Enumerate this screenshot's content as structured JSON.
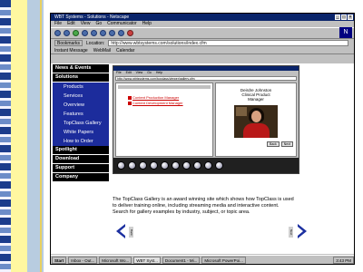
{
  "window": {
    "title": "WBT Systems - Solutions - Netscape",
    "controls": [
      "_",
      "□",
      "×"
    ]
  },
  "menubar": [
    "File",
    "Edit",
    "View",
    "Go",
    "Communicator",
    "Help"
  ],
  "location": {
    "bookmarks_label": "Bookmarks",
    "location_label": "Location:",
    "url": "http://www.wbtsystems.com/solutions/index.cfm"
  },
  "personal_toolbar": [
    "Instant Message",
    "WebMail",
    "Calendar"
  ],
  "nav": {
    "sections": [
      "News & Events",
      "Solutions"
    ],
    "solutions_items": [
      "Products",
      "Services",
      "Overview",
      "Features",
      "TopClass Gallery",
      "White Papers",
      "How to Order"
    ],
    "bottom_sections": [
      "Spotlight",
      "Download",
      "Support",
      "Company"
    ]
  },
  "inner_browser": {
    "menu": [
      "File",
      "Edit",
      "View",
      "Go",
      "Help"
    ],
    "url": "http://www.wbtsystems.com/topclass/viewer/gallery.cfm",
    "links": [
      "Content Production Manager",
      "Content Development Manager"
    ],
    "person_name": "Deirdre Johnston\nClinical Product\nManager",
    "buttons": [
      "Back",
      "Next"
    ]
  },
  "paragraph": "The TopClass Gallery is an award winning site which shows how TopClass is used to deliver training online, including streaming media and interactive content. Search for gallery examples by industry, subject, or topic area.",
  "nav_arrows": {
    "prev_label": "Back",
    "next_label": "Next"
  },
  "taskbar": {
    "start": "Start",
    "tasks": [
      "Inbox - Out...",
      "Microsoft Wo...",
      "WBT Syst...",
      "Document1 - Mi...",
      "Microsoft PowerPoi..."
    ],
    "active_task_index": 2,
    "clock": "3:43 PM"
  },
  "colors": {
    "nav_black": "#000000",
    "nav_blue": "#1c2c9c",
    "arrow_blue": "#1c30a0",
    "title_blue": "#0a246a",
    "link_red": "#cc0000"
  }
}
